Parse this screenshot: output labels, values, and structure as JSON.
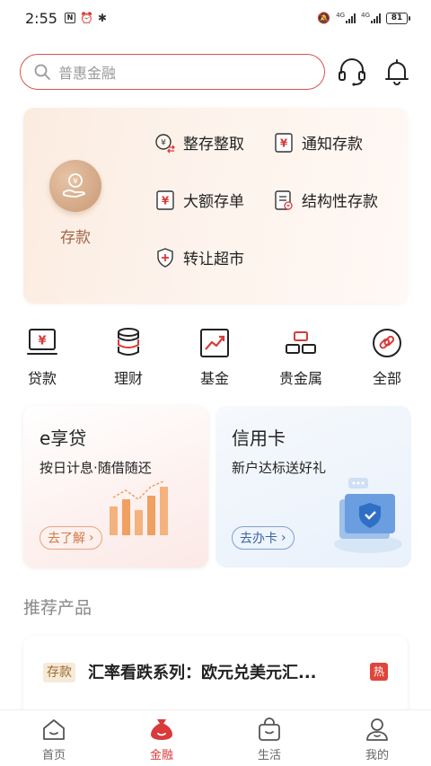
{
  "status_bar": {
    "time": "2:55",
    "net_label_1": "4G",
    "net_label_2": "4G",
    "battery": "81"
  },
  "search": {
    "placeholder": "普惠金融"
  },
  "deposit_section": {
    "main_label": "存款",
    "items": [
      {
        "label": "整存整取",
        "icon": "coin-exchange-icon"
      },
      {
        "label": "通知存款",
        "icon": "yen-card-icon"
      },
      {
        "label": "大额存单",
        "icon": "yen-card-icon"
      },
      {
        "label": "结构性存款",
        "icon": "document-icon"
      },
      {
        "label": "转让超市",
        "icon": "shield-plus-icon"
      }
    ]
  },
  "quick_menu": [
    {
      "label": "贷款",
      "icon": "loan-monitor-icon"
    },
    {
      "label": "理财",
      "icon": "coin-stack-icon"
    },
    {
      "label": "基金",
      "icon": "chart-up-icon"
    },
    {
      "label": "贵金属",
      "icon": "gold-bars-icon"
    },
    {
      "label": "全部",
      "icon": "link-circle-icon"
    }
  ],
  "promos": {
    "loan": {
      "title": "e享贷",
      "subtitle": "按日计息·随借随还",
      "button": "去了解"
    },
    "card": {
      "title": "信用卡",
      "subtitle": "新户达标送好礼",
      "button": "去办卡"
    }
  },
  "recommend": {
    "section_title": "推荐产品",
    "product": {
      "tag": "存款",
      "title": "汇率看跌系列：欧元兑美元汇...",
      "badge": "热"
    }
  },
  "tab_bar": [
    {
      "label": "首页",
      "icon": "home-icon",
      "active": false
    },
    {
      "label": "金融",
      "icon": "money-bag-icon",
      "active": true
    },
    {
      "label": "生活",
      "icon": "shopping-bag-icon",
      "active": false
    },
    {
      "label": "我的",
      "icon": "profile-icon",
      "active": false
    }
  ],
  "colors": {
    "accent": "#d93a3a",
    "deposit_brown": "#a0684a",
    "search_border": "#d9534f"
  }
}
